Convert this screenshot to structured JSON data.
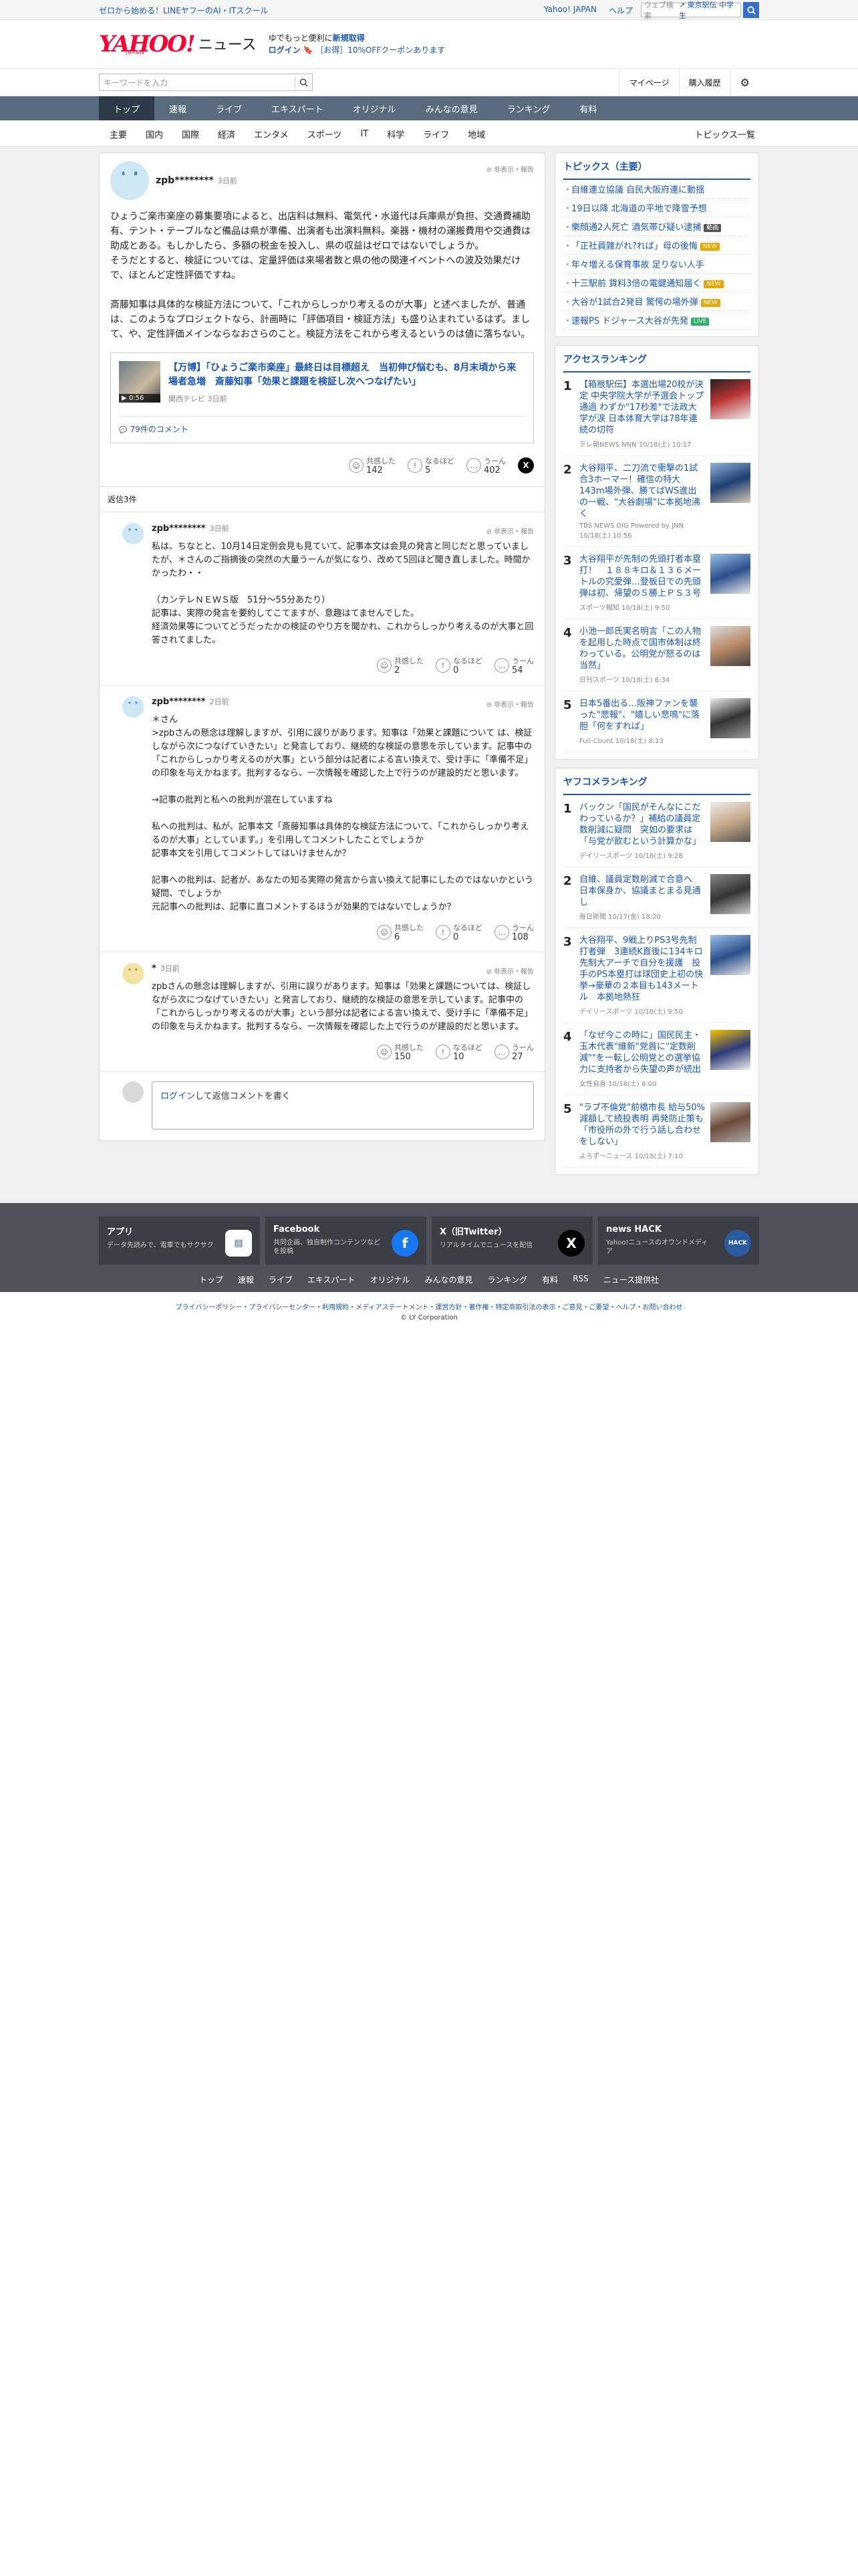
{
  "topbar": {
    "promo": "ゼロから始める！LINEヤフーのAI・ITスクール",
    "links": [
      "Yahoo! JAPAN",
      "ヘルプ"
    ],
    "search_placeholder": "ウェブ検索",
    "search_suggest": "東京駅伝 中学生"
  },
  "header": {
    "logo": "YAHOO!",
    "logo_sub": "JAPAN",
    "service": "ニュース",
    "tag_line1_prefix": "ゆでもっと便利に",
    "tag_line1_new": "新規取得",
    "tag_login": "ログイン",
    "tag_coupon": "［お得］10%OFFクーポンあります"
  },
  "searchrow": {
    "placeholder": "キーワードを入力",
    "mypage": "マイページ",
    "history": "購入履歴"
  },
  "nav": [
    "トップ",
    "速報",
    "ライブ",
    "エキスパート",
    "オリジナル",
    "みんなの意見",
    "ランキング",
    "有料"
  ],
  "subnav": [
    "主要",
    "国内",
    "国際",
    "経済",
    "エンタメ",
    "スポーツ",
    "IT",
    "科学",
    "ライフ",
    "地域"
  ],
  "subnav_last": "トピックス一覧",
  "post": {
    "user": "zpb********",
    "date": "3日前",
    "report": "非表示・報告",
    "body": "ひょうご楽市楽座の募集要項によると、出店料は無料、電気代・水道代は兵庫県が負担、交通費補助有、テント・テーブルなど備品は県が準備、出演者も出演料無料。楽器・機材の運搬費用や交通費は助成とある。もしかしたら、多額の税金を投入し、県の収益はゼロではないでしょうか。\nそうだとすると、検証については、定量評価は来場者数と県の他の関連イベントへの波及効果だけで、ほとんど定性評価ですね。\n\n斎藤知事は具体的な検証方法について、「これからしっかり考えるのが大事」と述べましたが、普通は、このようなプロジェクトなら、計画時に「評価項目・検証方法」も盛り込まれているはず。まして、や、定性評価メインならなおさらのこと。検証方法をこれから考えるというのは値に落ちない。",
    "quote_title": "【万博】「ひょうご楽市楽座」最終日は目標超え　当初伸び悩むも、8月末頃から来場者急増　斎藤知事「効果と課題を検証し次へつなげたい」",
    "quote_source": "関西テレビ 3日前",
    "quote_duration": "▶ 0:56",
    "comment_link": "79件のコメント",
    "reactions": [
      {
        "label": "共感した",
        "count": "142"
      },
      {
        "label": "なるほど",
        "count": "5"
      },
      {
        "label": "うーん",
        "count": "402"
      }
    ]
  },
  "reply_header": "返信3件",
  "replies": [
    {
      "user": "zpb********",
      "date": "3日前",
      "report": "非表示・報告",
      "body": "私は、ちなとと、10月14日定例会見も見ていて、記事本文は会見の発言と同じだと思っていましたが、＊さんのご指摘後の突然の大量うーんが気になり、改めて5回ほど聞き直しました。時間かかったわ・・\n\n（カンテレＮＥＷＳ版　51分〜55分あたり）\n記事は、実際の発言を要約してこてますが、意趣はてませんでした。\n経済効果等についてどうだったかの検証のやり方を聞かれ、これからしっかり考えるのが大事と回答されてました。",
      "avatar": "blue",
      "reactions": [
        {
          "label": "共感した",
          "count": "2"
        },
        {
          "label": "なるほど",
          "count": "0"
        },
        {
          "label": "うーん",
          "count": "54"
        }
      ]
    },
    {
      "user": "zpb********",
      "date": "2日前",
      "report": "非表示・報告",
      "body": "＊さん\n>zpbさんの懸念は理解しますが、引用に誤りがあります。知事は「効果と課題について は、検証しながら次につなげていきたい」と発言しており、継続的な検証の意思を示しています。記事中の「これからしっかり考えるのが大事」という部分は記者による言い換えで、受け手に「準備不足」の印象を与えかねます。批判するなら、一次情報を確認した上で行うのが建設的だと思います。\n\n→記事の批判と私への批判が混在していますね\n\n私への批判は、私が、記事本文「斎藤知事は具体的な検証方法について、「これからしっかり考えるのが大事」としています。」を引用してコメントしたことでしょうか\n記事本文を引用してコメントしてはいけませんか？\n\n記事への批判は、記者が、あなたの知る実際の発言から言い換えて記事にしたのではないかという疑問、でしょうか\n元記事への批判は、記事に直コメントするほうが効果的ではないでしょうか？",
      "avatar": "blue",
      "reactions": [
        {
          "label": "共感した",
          "count": "6"
        },
        {
          "label": "なるほど",
          "count": "0"
        },
        {
          "label": "うーん",
          "count": "108"
        }
      ]
    },
    {
      "user": "*",
      "date": "3日前",
      "report": "非表示・報告",
      "body": "zpbさんの懸念は理解しますが、引用に誤りがあります。知事は「効果と課題については、検証しながら次につなげていきたい」と発言しており、継続的な検証の意思を示しています。記事中の「これからしっかり考えるのが大事」という部分は記者による言い換えで、受け手に「準備不足」の印象を与えかねます。批判するなら、一次情報を確認した上で行うのが建設的だと思います。",
      "avatar": "yellow",
      "reactions": [
        {
          "label": "共感した",
          "count": "150"
        },
        {
          "label": "なるほど",
          "count": "10"
        },
        {
          "label": "うーん",
          "count": "27"
        }
      ]
    }
  ],
  "reply_form": {
    "login": "ログイン",
    "rest": "して返信コメントを書く"
  },
  "topics": {
    "title": "トピックス（主要）",
    "items": [
      {
        "text": "自維連立協議 自民大阪府連に動揺",
        "badge": ""
      },
      {
        "text": "19日以降 北海道の平地で降雪予想",
        "badge": ""
      },
      {
        "text": "樂顔通2人死亡 酒気帯び疑い逮捕",
        "badge": "動画"
      },
      {
        "text": "「正社員雑がれ?れば」母の後悔",
        "badge": "NEW"
      },
      {
        "text": "年々増える保育事故 足りない人手",
        "badge": ""
      },
      {
        "text": "十三駅前 貨料3倍の電鍵通知届く",
        "badge": "NEW"
      },
      {
        "text": "大谷が1試合2発目 驚愕の場外弾",
        "badge": "NEW"
      },
      {
        "text": "速報PS ドジャース大谷が先発",
        "badge": "LIVE"
      }
    ]
  },
  "access_ranking": {
    "title": "アクセスランキング",
    "items": [
      {
        "title": "【箱根駅伝】本選出場20校が決定 中央学院大学が予選会トップ通過 わずか\"17秒差\"で法政大学が涙 日本体育大学は78年連続の切符",
        "source": "テレ朝NEWS NNN 10/18(土) 10:17"
      },
      {
        "title": "大谷翔平、二刀流で衝撃の1試合3ホーマー！確信の特大143m場外弾、勝てばWS進出の一戦、\"大谷劇場\"に本拠地沸く",
        "source": "TBS NEWS DIG Powered by JNN 10/18(土) 10:56"
      },
      {
        "title": "大谷翔平が先制の先頭打者本塁打！　１８８キロ＆１３６メートルの究愛弾…登板日での先頭弾は初、帰望の５勝上ＰＳ３号",
        "source": "スポーツ報知 10/18(土) 9:50"
      },
      {
        "title": "小池一郎氏実名明言「この人物を起用した時点で国市体制は終わっている。公明党が怒るのは当然」",
        "source": "日刊スポーツ 10/18(土) 6:34"
      },
      {
        "title": "日本5番出る…阪神ファンを襲った\"悲報\"、\"嬉しい悲鳴\"に落胆「何をすれば」",
        "source": "Full-Count 10/18(土) 8:13"
      }
    ]
  },
  "yafuko_ranking": {
    "title": "ヤフコメランキング",
    "items": [
      {
        "title": "バックン「国民がそんなにこだわっているか？」補給の議員定数削減に疑問　突如の要求は「与党が飲むという計算かな」",
        "source": "デイリースポーツ 10/18(土) 9:28"
      },
      {
        "title": "自維、議員定数削減で合意へ　日本保身か、協議まとまる見通し",
        "source": "毎日新聞 10/17(金) 18:20"
      },
      {
        "title": "大谷翔平、9戦上りPS3号先制打者弾　3連続K直後に134キロ先制大アーチで自分を援護　投手のPS本塁打は球団史上初の快挙→豪華の２本目も143メートル　本拠地熱狂",
        "source": "デイリースポーツ 10/18(土) 9:50"
      },
      {
        "title": "「なぜ今この時に」国民民主・玉木代表\"維新\"党首に\"定数削減\"\"を一転し公明党との選挙協力に支持者から失望の声が続出",
        "source": "女性自身 10/18(土) 6:00"
      },
      {
        "title": "\"ラブ不倫党\"前橋市長 給与50%減額して続投表明 再発防止策も「市役所の外で行う話し合わせをしない」",
        "source": "よろず〜ニュース 10/18(土) 7:10"
      }
    ]
  },
  "footer": {
    "cards": [
      {
        "title": "アプリ",
        "desc": "データ先読みで、電車でもサクサク"
      },
      {
        "title": "Facebook",
        "desc": "共同企画、独自制作コンテンツなどを投稿"
      },
      {
        "title": "X（旧Twitter）",
        "desc": "リアルタイムでニュースを配信"
      },
      {
        "title": "news HACK",
        "desc": "Yahoo!ニュースのオウンドメディア"
      }
    ],
    "links": [
      "トップ",
      "速報",
      "ライブ",
      "エキスパート",
      "オリジナル",
      "みんなの意見",
      "ランキング",
      "有料",
      "RSS",
      "ニュース提供社"
    ],
    "bottom_links": "プライバシーポリシー・プライバシーセンター・利用規約・メディアステートメント・運営方針・著作権・特定商取引法の表示・ご意見・ご要望・ヘルプ・お問い合わせ",
    "copyright": "© LY Corporation"
  }
}
